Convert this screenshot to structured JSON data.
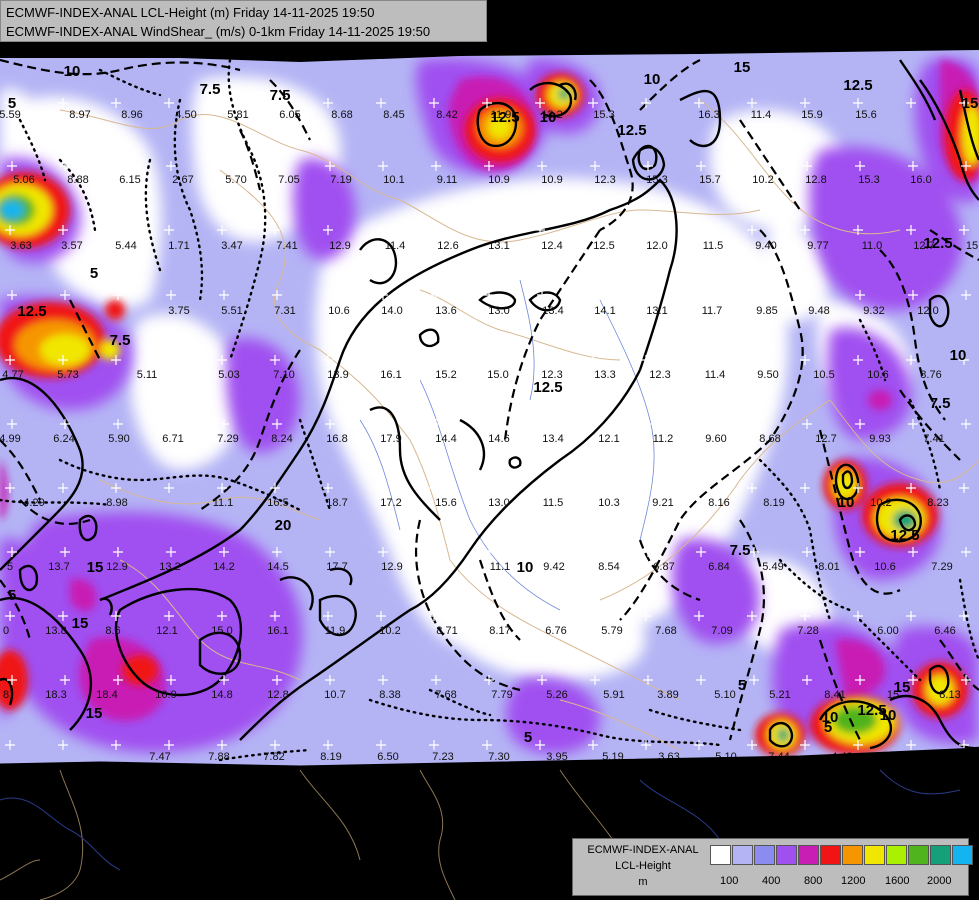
{
  "header": {
    "line1": "ECMWF-INDEX-ANAL LCL-Height (m) Friday 14-11-2025 19:50",
    "line2": "ECMWF-INDEX-ANAL WindShear_ (m/s) 0-1km Friday 14-11-2025 19:50"
  },
  "legend": {
    "title": "ECMWF-INDEX-ANAL",
    "param": "LCL-Height",
    "unit": "m",
    "colors": [
      "#ffffff",
      "#b4b4f5",
      "#8c8cf0",
      "#a050f0",
      "#c81eb4",
      "#f01414",
      "#f59600",
      "#f0e600",
      "#aaf000",
      "#50b41e",
      "#14a078",
      "#14b4f0"
    ],
    "ticks": [
      "100",
      "400",
      "800",
      "1200",
      "1600",
      "2000"
    ]
  },
  "values": {
    "row1": [
      "5.59",
      "8.97",
      "8.96",
      "4.50",
      "5.81",
      "6.05",
      "8.68",
      "8.45",
      "8.42",
      "11.9",
      "13.2",
      "15.3",
      "16.3",
      "11.4",
      "15.9",
      "15.6"
    ],
    "row2": [
      "5.06",
      "8.88",
      "6.15",
      "2.67",
      "5.70",
      "7.05",
      "7.19",
      "10.1",
      "9.11",
      "10.9",
      "10.9",
      "12.3",
      "15.3",
      "15.7",
      "10.2",
      "12.8",
      "15.3",
      "16.0"
    ],
    "row3": [
      "3.63",
      "3.57",
      "5.44",
      "1.71",
      "3.47",
      "7.41",
      "12.9",
      "11.4",
      "12.6",
      "13.1",
      "12.4",
      "12.5",
      "12.0",
      "11.5",
      "9.40",
      "9.77",
      "11.0",
      "12.7",
      "15"
    ],
    "row4": [
      "3.75",
      "5.51",
      "7.31",
      "10.6",
      "14.0",
      "13.6",
      "13.0",
      "13.4",
      "14.1",
      "13.1",
      "11.7",
      "9.85",
      "9.48",
      "9.32",
      "12.0"
    ],
    "row5": [
      "4.77",
      "5.73",
      "5.11",
      "5.03",
      "7.10",
      "13.9",
      "16.1",
      "15.2",
      "15.0",
      "12.3",
      "13.3",
      "12.3",
      "11.4",
      "9.50",
      "10.5",
      "10.6",
      "8.76"
    ],
    "row6": [
      "4.99",
      "6.24",
      "5.90",
      "6.71",
      "7.29",
      "8.24",
      "16.8",
      "17.9",
      "14.4",
      "14.6",
      "13.4",
      "12.1",
      "11.2",
      "9.60",
      "8.68",
      "12.7",
      "9.93",
      "7.41"
    ],
    "row7": [
      "4.29",
      "8.98",
      "11.1",
      "16.5",
      "18.7",
      "17.2",
      "15.6",
      "13.0",
      "11.5",
      "10.3",
      "9.21",
      "8.16",
      "8.19",
      "10.2",
      "8.23"
    ],
    "row8": [
      "5",
      "13.7",
      "12.9",
      "13.2",
      "14.2",
      "14.5",
      "17.7",
      "12.9",
      "11.1",
      "9.42",
      "8.54",
      "6.87",
      "6.84",
      "5.49",
      "8.01",
      "10.6",
      "7.29"
    ],
    "row9": [
      "0",
      "13.8",
      "8.6",
      "12.1",
      "15.0",
      "16.1",
      "11.9",
      "10.2",
      "8.71",
      "8.17",
      "6.76",
      "5.79",
      "7.68",
      "7.09",
      "7.28",
      "6.00",
      "6.46"
    ],
    "row10": [
      "8",
      "18.3",
      "18.4",
      "16.9",
      "14.8",
      "12.8",
      "10.7",
      "8.38",
      "7.68",
      "7.79",
      "5.26",
      "5.91",
      "3.89",
      "5.10",
      "5.21",
      "8.41",
      "15",
      "8.13"
    ],
    "row11": [
      "7.47",
      "7.88",
      "7.82",
      "8.19",
      "6.50",
      "7.23",
      "7.30",
      "3.95",
      "5.19",
      "3.63",
      "5.10",
      "7.44",
      "4.48"
    ]
  },
  "contour_labels": [
    "10",
    "7.5",
    "5",
    "7.5",
    "10",
    "12.5",
    "10",
    "12.5",
    "15",
    "12.5",
    "15",
    "12.5",
    "5",
    "12.5",
    "7.5",
    "12.5",
    "10",
    "5",
    "20",
    "15",
    "15",
    "15",
    "10",
    "7.5",
    "12.5",
    "12.5",
    "15",
    "10",
    "10",
    "7.5",
    "5",
    "5",
    "5",
    "10"
  ]
}
